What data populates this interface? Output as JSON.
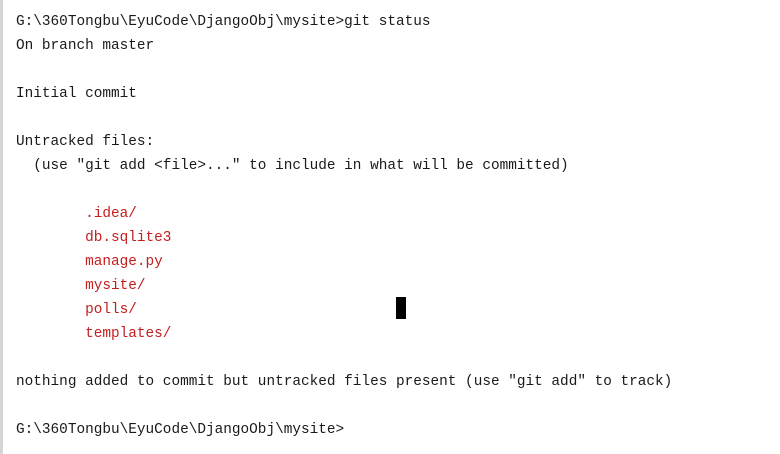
{
  "terminal": {
    "lines": [
      {
        "text": "G:\\360Tongbu\\EyuCode\\DjangoObj\\mysite>git status",
        "type": "prompt"
      },
      {
        "text": "On branch master",
        "type": "output"
      },
      {
        "text": "",
        "type": "blank"
      },
      {
        "text": "Initial commit",
        "type": "output"
      },
      {
        "text": "",
        "type": "blank"
      },
      {
        "text": "Untracked files:",
        "type": "output"
      },
      {
        "text": "  (use \"git add <file>...\" to include in what will be committed)",
        "type": "output"
      },
      {
        "text": "",
        "type": "blank"
      },
      {
        "text": "        .idea/",
        "type": "untracked"
      },
      {
        "text": "        db.sqlite3",
        "type": "untracked"
      },
      {
        "text": "        manage.py",
        "type": "untracked"
      },
      {
        "text": "        mysite/",
        "type": "untracked"
      },
      {
        "text": "        polls/",
        "type": "untracked"
      },
      {
        "text": "        templates/",
        "type": "untracked"
      },
      {
        "text": "",
        "type": "blank"
      },
      {
        "text": "nothing added to commit but untracked files present (use \"git add\" to track)",
        "type": "output"
      },
      {
        "text": "",
        "type": "blank"
      },
      {
        "text": "G:\\360Tongbu\\EyuCode\\DjangoObj\\mysite>",
        "type": "prompt"
      }
    ]
  },
  "colors": {
    "background": "#ffffff",
    "text": "#1a1a1a",
    "untracked": "#c41e1e",
    "cursor": "#000000"
  }
}
